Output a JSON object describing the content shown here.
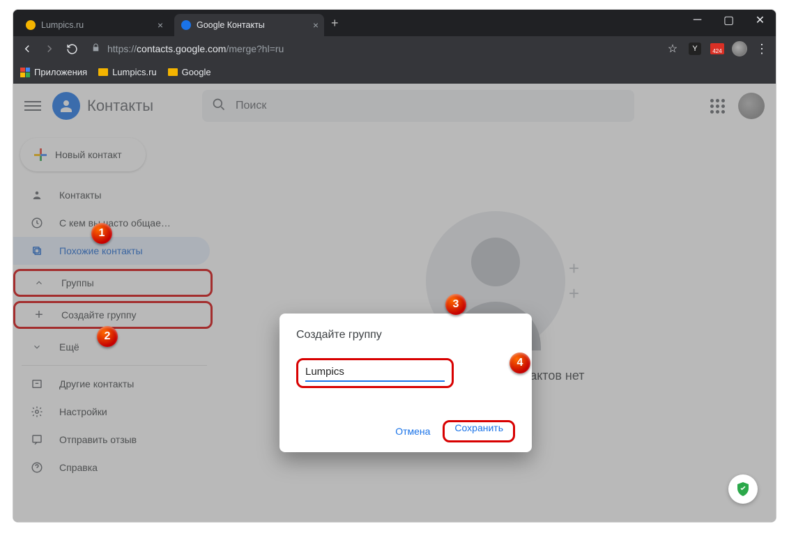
{
  "browser": {
    "tabs": [
      {
        "title": "Lumpics.ru",
        "favicon_color": "#f4b400"
      },
      {
        "title": "Google Контакты",
        "favicon_color": "#1a73e8"
      }
    ],
    "url_proto": "https://",
    "url_host": "contacts.google.com",
    "url_path": "/merge?hl=ru",
    "gmail_badge": "424",
    "bookmarks": {
      "apps": "Приложения",
      "folder1": "Lumpics.ru",
      "folder2": "Google"
    }
  },
  "header": {
    "title": "Контакты",
    "search_placeholder": "Поиск"
  },
  "sidebar": {
    "new_contact": "Новый контакт",
    "items": {
      "contacts": "Контакты",
      "frequent": "С кем вы часто общае…",
      "duplicates": "Похожие контакты",
      "groups": "Группы",
      "create_group": "Создайте группу",
      "more": "Ещё",
      "other": "Другие контакты",
      "settings": "Настройки",
      "feedback": "Отправить отзыв",
      "help": "Справка"
    }
  },
  "main": {
    "empty_label": "Повторяющихся контактов нет"
  },
  "dialog": {
    "title": "Создайте группу",
    "input_value": "Lumpics",
    "cancel": "Отмена",
    "save": "Сохранить"
  },
  "annotations": {
    "m1": "1",
    "m2": "2",
    "m3": "3",
    "m4": "4"
  }
}
